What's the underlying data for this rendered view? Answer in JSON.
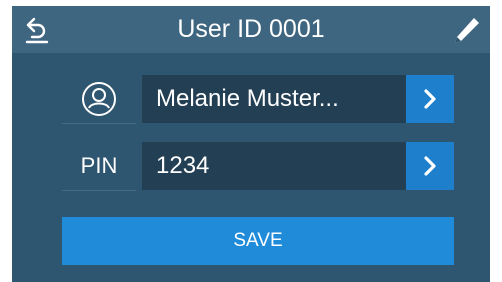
{
  "header": {
    "title": "User ID 0001",
    "back_icon": "undo-arrow-icon",
    "edit_icon": "pencil-icon"
  },
  "user": {
    "name_icon": "user-profile-icon",
    "name_value": "Melanie Muster...",
    "pin_label": "PIN",
    "pin_value": "1234",
    "arrow_icon": "chevron-right-icon"
  },
  "actions": {
    "save_label": "SAVE"
  },
  "colors": {
    "background": "#2f5670",
    "header": "#3f6680",
    "field": "#233f54",
    "accent": "#1e7fcc"
  }
}
